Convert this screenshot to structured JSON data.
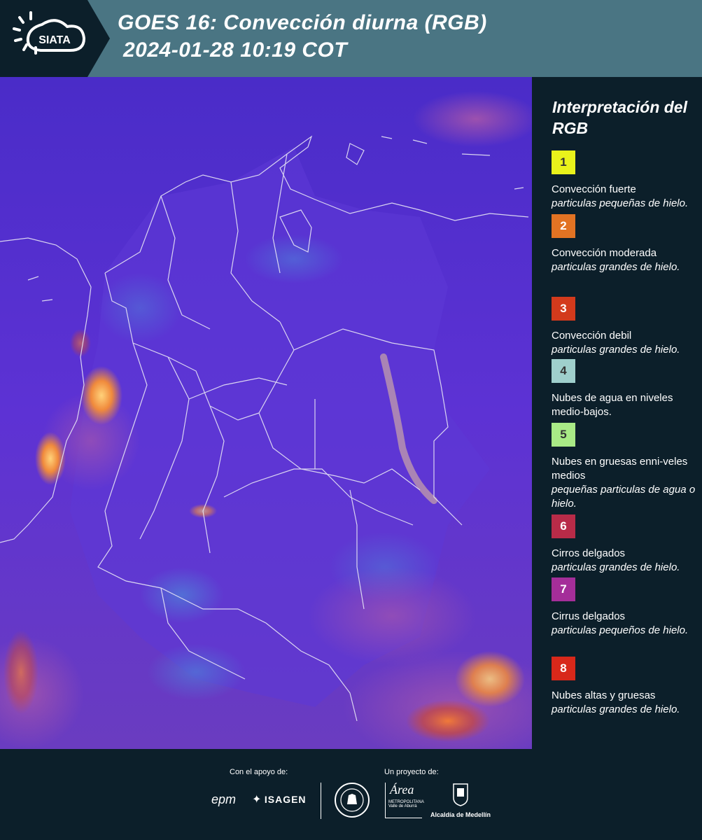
{
  "header": {
    "logo_text": "SIATA",
    "title_line1": "GOES 16: Convección diurna (RGB)",
    "title_line2": "2024-01-28 10:19 COT"
  },
  "legend": {
    "title": "Interpretación del RGB",
    "items": [
      {
        "num": "1",
        "color": "#e9f21b",
        "text": "Convección fuerte",
        "sub": "particulas pequeñas de hielo."
      },
      {
        "num": "2",
        "color": "#e27323",
        "text": "Convección moderada",
        "sub": "particulas grandes de hielo."
      },
      {
        "num": "3",
        "color": "#d33a1c",
        "text": "Convección debil",
        "sub": "particulas grandes de hielo."
      },
      {
        "num": "4",
        "color": "#9fcfcc",
        "text": "Nubes de agua en niveles medio-bajos.",
        "sub": ""
      },
      {
        "num": "5",
        "color": "#a9ea86",
        "text": "Nubes en gruesas enni-veles medios",
        "sub": "pequeñas particulas de agua o hielo."
      },
      {
        "num": "6",
        "color": "#b82b48",
        "text": "Cirros delgados",
        "sub": "particulas grandes de hielo."
      },
      {
        "num": "7",
        "color": "#a42e99",
        "text": "Cirrus delgados",
        "sub": "particulas pequeños de hielo."
      },
      {
        "num": "8",
        "color": "#d8281a",
        "text": "Nubes altas y gruesas",
        "sub": "particulas grandes de hielo."
      }
    ]
  },
  "footer": {
    "support_label": "Con el apoyo de:",
    "project_label": "Un proyecto de:",
    "logos": {
      "epm": "epm",
      "isagen": "ISAGEN",
      "area_metropolitana": "Área",
      "area_sub": "METROPOLITANA",
      "area_sub2": "Valle de Aburrá",
      "alcaldia": "Alcaldía de Medellín"
    }
  },
  "colors": {
    "header_bg": "#4a7583",
    "page_bg": "#0c1f2a",
    "map_base": "#5a2fd0"
  }
}
